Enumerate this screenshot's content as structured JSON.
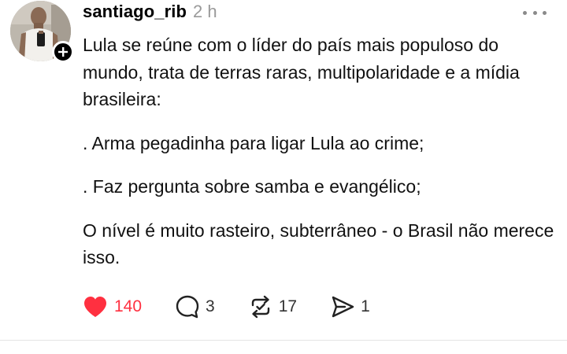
{
  "post": {
    "author": {
      "username": "santiago_rib",
      "avatar_icon": "user-photo-avatar"
    },
    "timestamp": "2 h",
    "menu_icon": "more-horizontal-icon",
    "paragraphs": [
      "Lula se reúne com o líder do país mais populoso do mundo, trata de terras raras, multipolaridade e a mídia brasileira:",
      ". Arma pegadinha para ligar Lula ao crime;",
      ". Faz pergunta sobre samba e evangélico;",
      "O nível é muito rasteiro, subterrâneo - o Brasil não merece isso."
    ],
    "actions": {
      "likes": "140",
      "replies": "3",
      "reposts": "17",
      "shares": "1"
    }
  },
  "colors": {
    "like": "#ff3040",
    "text": "#111111",
    "muted": "#9a9a9a",
    "badge": "#000000"
  }
}
